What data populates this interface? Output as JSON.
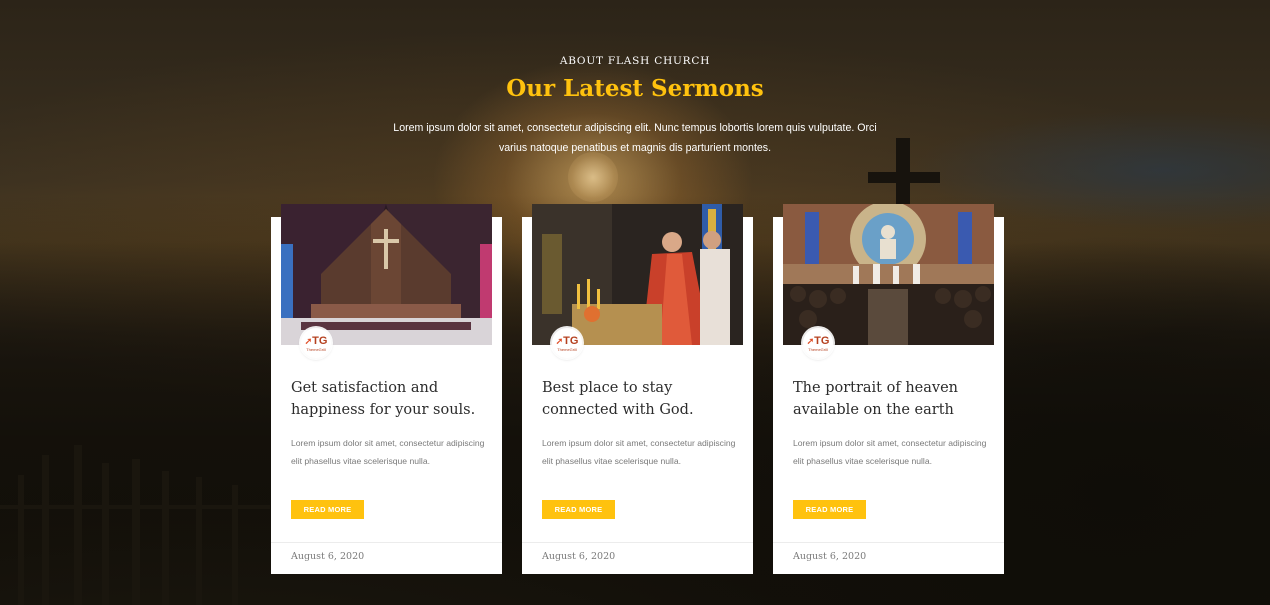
{
  "section": {
    "kicker": "ABOUT FLASH CHURCH",
    "title": "Our Latest Sermons",
    "intro": "Lorem ipsum dolor sit amet, consectetur adipiscing elit. Nunc tempus lobortis lorem quis vulputate. Orci varius natoque penatibus et magnis dis parturient montes."
  },
  "colors": {
    "accent": "#ffc20e",
    "card_bg": "#ffffff",
    "title_text": "#2c2c2c",
    "body_text": "#7a7a7a"
  },
  "cards": [
    {
      "image": "church-interior-wooden-altar-photo",
      "avatar_label": "TG",
      "avatar_name": "ThemeGrill",
      "title": "Get satisfaction and happiness for your souls.",
      "excerpt": "Lorem ipsum dolor sit amet, consectetur adipiscing elit phasellus vitae scelerisque nulla.",
      "button": "READ MORE",
      "date": "August 6, 2020"
    },
    {
      "image": "priest-lighting-candles-photo",
      "avatar_label": "TG",
      "avatar_name": "ThemeGrill",
      "title": "Best place to stay connected with God.",
      "excerpt": "Lorem ipsum dolor sit amet, consectetur adipiscing elit phasellus vitae scelerisque nulla.",
      "button": "READ MORE",
      "date": "August 6, 2020"
    },
    {
      "image": "cathedral-mass-congregation-photo",
      "avatar_label": "TG",
      "avatar_name": "ThemeGrill",
      "title": "The portrait of heaven available on the earth",
      "excerpt": "Lorem ipsum dolor sit amet, consectetur adipiscing elit phasellus vitae scelerisque nulla.",
      "button": "READ MORE",
      "date": "August 6, 2020"
    }
  ]
}
